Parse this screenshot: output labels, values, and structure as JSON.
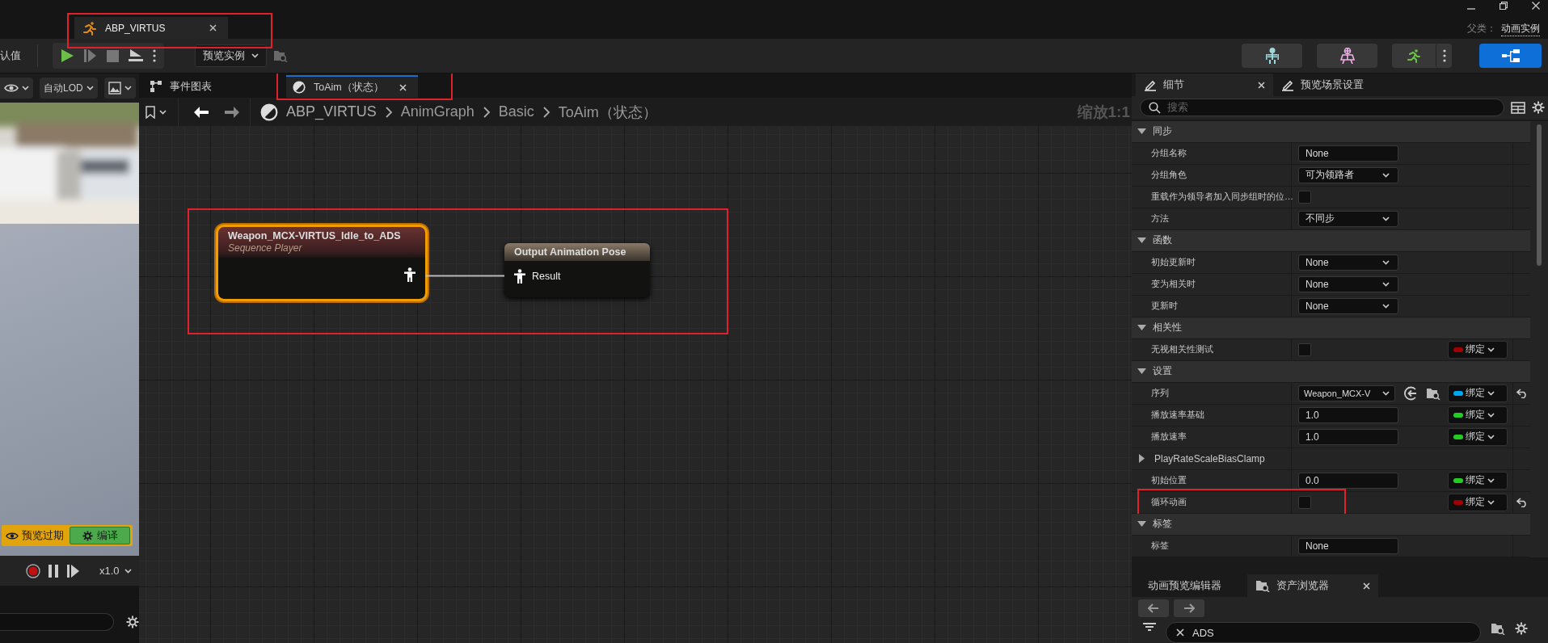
{
  "title_bar": {
    "tabs": [
      {
        "label": "ABP_VIRTUS",
        "selected": true,
        "highlighted": true
      }
    ],
    "parent_label": "父类：",
    "parent_value": "动画实例"
  },
  "toolbar": {
    "defaults_label": "认值",
    "preview_dropdown": "预览实例"
  },
  "viewport": {
    "lod_dropdown": "自动LOD",
    "banner_text": "预览过期",
    "compile_button": "编译",
    "speed": "x1.0"
  },
  "graph": {
    "tabs": [
      {
        "label": "事件图表",
        "selected": false,
        "highlighted": false
      },
      {
        "label": "ToAim（状态）",
        "selected": true,
        "highlighted": true
      }
    ],
    "breadcrumbs": [
      "ABP_VIRTUS",
      "AnimGraph",
      "Basic",
      "ToAim（状态）"
    ],
    "zoom_label": "缩放1:1",
    "nodes_highlighted": true,
    "nodes": [
      {
        "kind": "sequence",
        "title": "Weapon_MCX-VIRTUS_Idle_to_ADS",
        "subtitle": "Sequence Player",
        "selected": true
      },
      {
        "kind": "output",
        "title": "Output Animation Pose",
        "pin": "Result",
        "selected": false
      }
    ]
  },
  "details": {
    "tabs": [
      {
        "label": "细节",
        "selected": true
      },
      {
        "label": "预览场景设置",
        "selected": false
      }
    ],
    "search": {
      "placeholder": "搜索"
    },
    "rows": [
      {
        "kind": "category",
        "label": "同步",
        "expanded": true
      },
      {
        "kind": "text",
        "label": "分组名称",
        "value": "None"
      },
      {
        "kind": "dropdown",
        "label": "分组角色",
        "value": "可为领路者"
      },
      {
        "kind": "checkbox",
        "label": "重载作为领导者加入同步组时的位…",
        "checked": false
      },
      {
        "kind": "dropdown",
        "label": "方法",
        "value": "不同步"
      },
      {
        "kind": "category",
        "label": "函数",
        "expanded": true
      },
      {
        "kind": "dropdown",
        "label": "初始更新时",
        "value": "None"
      },
      {
        "kind": "dropdown",
        "label": "变为相关时",
        "value": "None"
      },
      {
        "kind": "dropdown",
        "label": "更新时",
        "value": "None"
      },
      {
        "kind": "category",
        "label": "相关性",
        "expanded": true
      },
      {
        "kind": "checkbox",
        "label": "无视相关性测试",
        "checked": false,
        "binding": {
          "label": "绑定",
          "color": "#a00000"
        }
      },
      {
        "kind": "category",
        "label": "设置",
        "expanded": true
      },
      {
        "kind": "asset",
        "label": "序列",
        "value": "Weapon_MCX-V",
        "binding": {
          "label": "绑定",
          "color": "#00a8f0"
        },
        "resettable": true
      },
      {
        "kind": "text",
        "label": "播放速率基础",
        "value": "1.0",
        "binding": {
          "label": "绑定",
          "color": "#22cc22"
        }
      },
      {
        "kind": "text",
        "label": "播放速率",
        "value": "1.0",
        "binding": {
          "label": "绑定",
          "color": "#22cc22"
        }
      },
      {
        "kind": "group",
        "label": "PlayRateScaleBiasClamp",
        "expanded": false
      },
      {
        "kind": "text",
        "label": "初始位置",
        "value": "0.0",
        "binding": {
          "label": "绑定",
          "color": "#22cc22"
        }
      },
      {
        "kind": "checkbox",
        "label": "循环动画",
        "checked": false,
        "binding": {
          "label": "绑定",
          "color": "#a00000"
        },
        "resettable": true,
        "highlighted": true
      },
      {
        "kind": "category",
        "label": "标签",
        "expanded": true
      },
      {
        "kind": "text",
        "label": "标签",
        "value": "None"
      }
    ]
  },
  "bottom_panel": {
    "tabs": [
      {
        "label": "动画预览编辑器",
        "selected": false
      },
      {
        "label": "资产浏览器",
        "selected": true
      }
    ],
    "search": {
      "value": "ADS"
    }
  }
}
